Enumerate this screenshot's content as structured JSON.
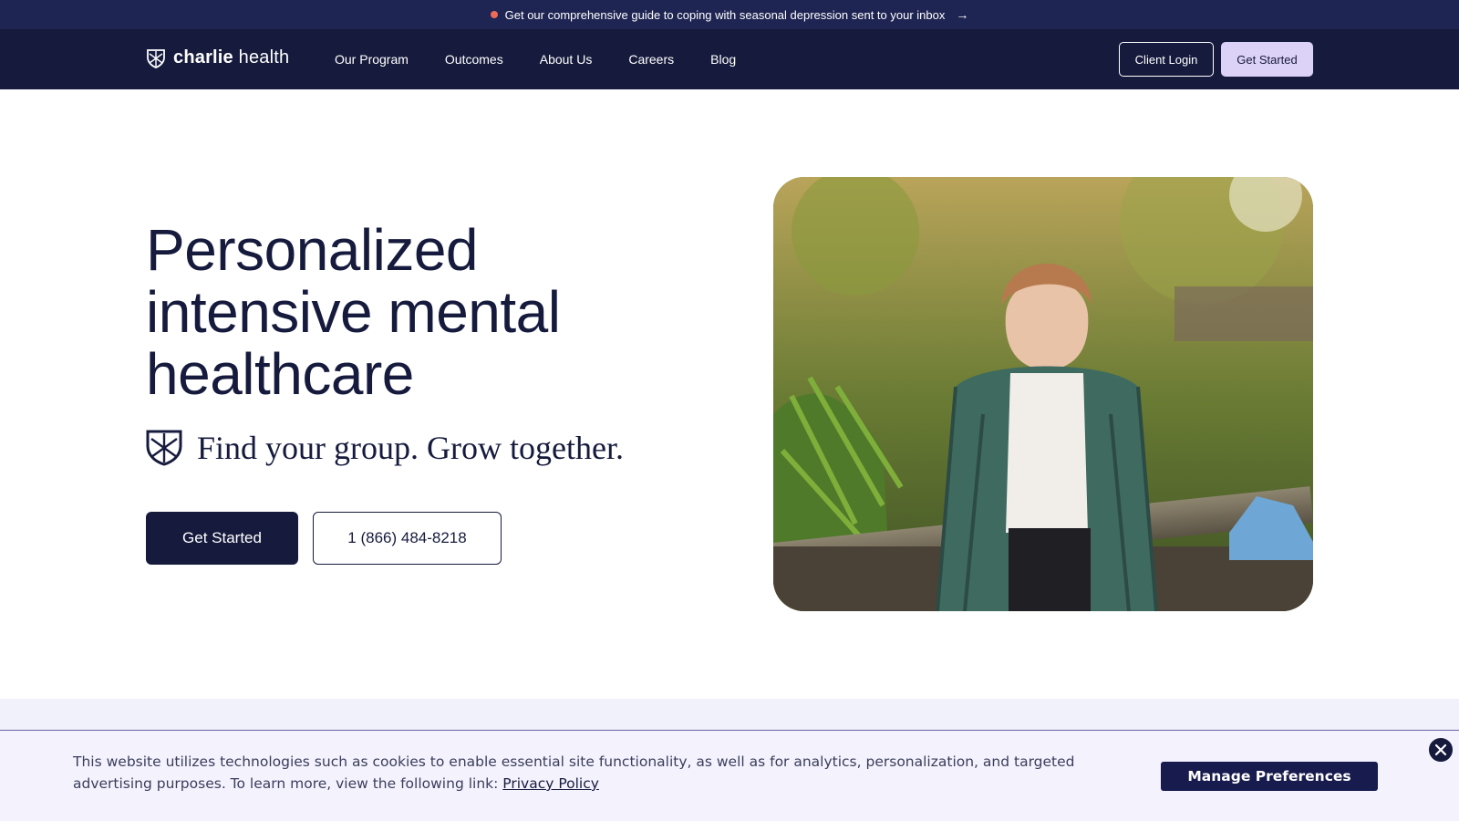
{
  "announcement": {
    "text": "Get our comprehensive guide to coping with seasonal depression sent to your inbox",
    "arrow": "→"
  },
  "nav": {
    "brand_bold": "charlie",
    "brand_light": " health",
    "links": [
      "Our Program",
      "Outcomes",
      "About Us",
      "Careers",
      "Blog"
    ],
    "login_label": "Client Login",
    "get_started_label": "Get Started"
  },
  "hero": {
    "title": "Personalized intensive mental healthcare",
    "tagline": "Find your group. Grow together.",
    "cta_primary": "Get Started",
    "cta_phone": "1 (866) 484-8218"
  },
  "cookie_banner": {
    "text": "This website utilizes technologies such as cookies to enable essential site functionality, as well as for analytics, personalization, and targeted advertising purposes. To learn more, view the following link: ",
    "link_label": "Privacy Policy",
    "manage_label": "Manage Preferences"
  },
  "colors": {
    "navy": "#161b3d",
    "announcement_bg": "#1f2553",
    "lavender_button": "#dcd1f7",
    "cookie_bg": "#f4f3fd",
    "accent_dot": "#f06a5a"
  },
  "icons": [
    "charlie-health-shield-icon",
    "arrow-right-icon",
    "close-icon"
  ]
}
